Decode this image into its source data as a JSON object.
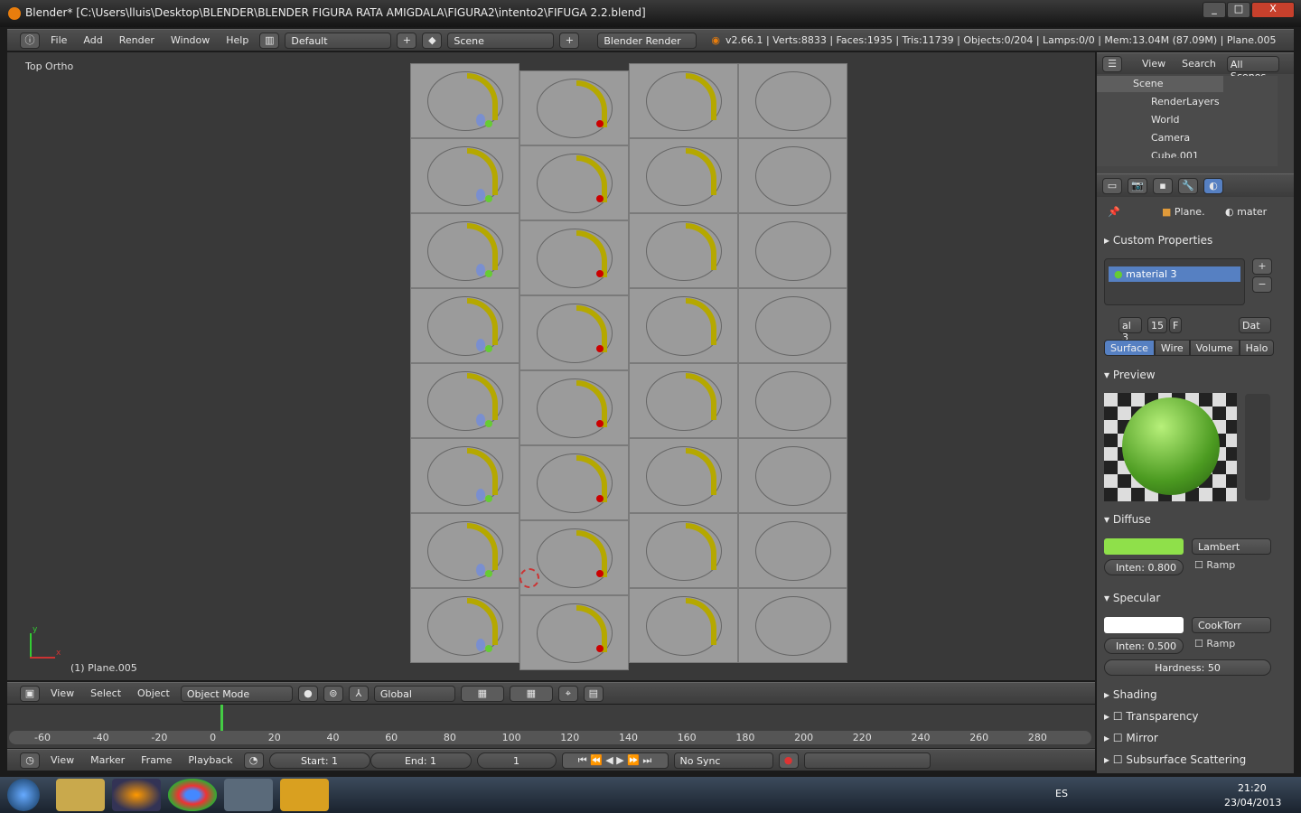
{
  "window": {
    "title": "Blender* [C:\\Users\\lluis\\Desktop\\BLENDER\\BLENDER FIGURA RATA AMIGDALA\\FIGURA2\\intento2\\FIFUGA 2.2.blend]",
    "min": "_",
    "max": "□",
    "close": "X"
  },
  "info_header": {
    "menus": [
      "File",
      "Add",
      "Render",
      "Window",
      "Help"
    ],
    "layout": "Default",
    "scene": "Scene",
    "engine": "Blender Render",
    "stats": "v2.66.1 | Verts:8833 | Faces:1935 | Tris:11739 | Objects:0/204 | Lamps:0/0 | Mem:13.04M (87.09M) | Plane.005"
  },
  "viewport": {
    "view_label": "Top Ortho",
    "object_label": "(1) Plane.005",
    "axis_x": "x",
    "axis_y": "y",
    "grid_rows": 8,
    "grid_cols": 4
  },
  "view3d_header": {
    "menus": [
      "View",
      "Select",
      "Object"
    ],
    "mode": "Object Mode",
    "orientation": "Global"
  },
  "timeline": {
    "ticks": [
      "-60",
      "-40",
      "-20",
      "0",
      "20",
      "40",
      "60",
      "80",
      "100",
      "120",
      "140",
      "160",
      "180",
      "200",
      "220",
      "240",
      "260",
      "280"
    ],
    "current_frame_marker": 0,
    "menus": [
      "View",
      "Marker",
      "Frame",
      "Playback"
    ],
    "start": "Start: 1",
    "end": "End: 1",
    "current": "1",
    "sync": "No Sync"
  },
  "outliner": {
    "menus": [
      "View",
      "Search"
    ],
    "filter": "All Scenes",
    "items": [
      "Scene",
      "RenderLayers",
      "World",
      "Camera",
      "Cube.001"
    ]
  },
  "properties": {
    "breadcrumb": [
      "Plane.",
      "mater"
    ],
    "custom_properties": "Custom Properties",
    "material_slot": "material 3",
    "mat_name": "al 3",
    "users": "15",
    "fake": "F",
    "data": "Dat",
    "tabs": [
      "Surface",
      "Wire",
      "Volume",
      "Halo"
    ],
    "active_tab": "Surface",
    "preview": "Preview",
    "diffuse": {
      "label": "Diffuse",
      "color": "#8fe04a",
      "shader": "Lambert",
      "intensity": "Inten: 0.800",
      "intensity_value": 0.8,
      "ramp": "Ramp"
    },
    "specular": {
      "label": "Specular",
      "color": "#ffffff",
      "shader": "CookTorr",
      "intensity": "Inten: 0.500",
      "intensity_value": 0.5,
      "ramp": "Ramp",
      "hardness": "Hardness: 50"
    },
    "panels": [
      "Shading",
      "Transparency",
      "Mirror",
      "Subsurface Scattering"
    ]
  },
  "taskbar": {
    "lang": "ES",
    "time": "21:20",
    "date": "23/04/2013"
  }
}
